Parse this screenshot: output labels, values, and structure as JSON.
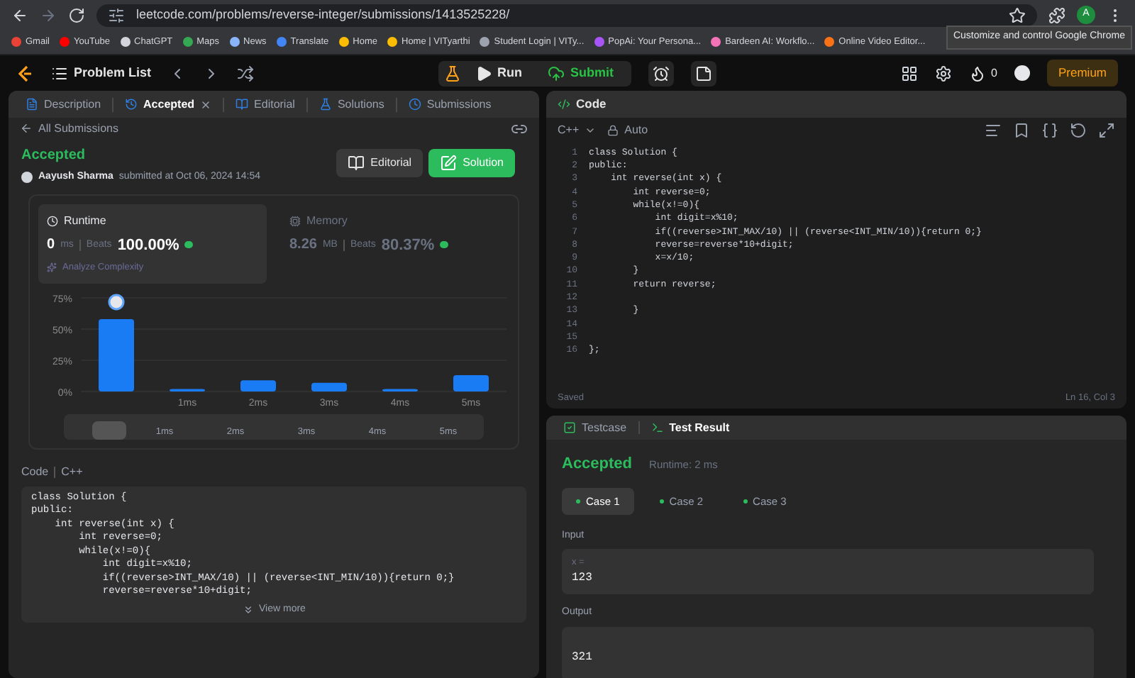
{
  "browser": {
    "url": "leetcode.com/problems/reverse-integer/submissions/1413525228/",
    "avatar": "A",
    "tooltip": "Customize and control Google Chrome",
    "bookmarks": [
      {
        "label": "Gmail",
        "color": "#ea4335"
      },
      {
        "label": "YouTube",
        "color": "#ff0000"
      },
      {
        "label": "ChatGPT",
        "color": "#d1d5db"
      },
      {
        "label": "Maps",
        "color": "#34a853"
      },
      {
        "label": "News",
        "color": "#8ab4f8"
      },
      {
        "label": "Translate",
        "color": "#4285f4"
      },
      {
        "label": "Home",
        "color": "#fbbc04"
      },
      {
        "label": "Home | VITyarthi",
        "color": "#fbbc04"
      },
      {
        "label": "Student Login | VITy...",
        "color": "#9ca3af"
      },
      {
        "label": "PopAi: Your Persona...",
        "color": "#a855f7"
      },
      {
        "label": "Bardeen AI: Workflo...",
        "color": "#f472b6"
      },
      {
        "label": "Online Video Editor...",
        "color": "#f97316"
      }
    ]
  },
  "nav": {
    "problem_list": "Problem List",
    "run": "Run",
    "submit": "Submit",
    "streak": "0",
    "premium": "Premium"
  },
  "left": {
    "tabs": [
      {
        "label": "Description",
        "selected": false
      },
      {
        "label": "Accepted",
        "selected": true,
        "closable": true
      },
      {
        "label": "Editorial",
        "selected": false
      },
      {
        "label": "Solutions",
        "selected": false
      },
      {
        "label": "Submissions",
        "selected": false
      }
    ],
    "back": "All Submissions",
    "status": "Accepted",
    "author": "Aayush Sharma",
    "submitted": "submitted at Oct 06, 2024 14:54",
    "editorial_button": "Editorial",
    "solution_button": "Solution",
    "runtime": {
      "title": "Runtime",
      "value": "0",
      "unit": "ms",
      "beats": "Beats",
      "percent": "100.00%",
      "analyze": "Analyze Complexity",
      "selected": true
    },
    "memory": {
      "title": "Memory",
      "value": "8.26",
      "unit": "MB",
      "beats": "Beats",
      "percent": "80.37%",
      "selected": false
    },
    "chart_data": {
      "type": "bar",
      "categories": [
        null,
        "1ms",
        "2ms",
        "3ms",
        "4ms",
        "5ms"
      ],
      "values": [
        58,
        2,
        9,
        7,
        2,
        13
      ],
      "ylim": [
        0,
        75
      ],
      "yticks": [
        {
          "value": 0,
          "label": "0%"
        },
        {
          "value": 25,
          "label": "25%"
        },
        {
          "value": 50,
          "label": "50%"
        },
        {
          "value": 75,
          "label": "75%"
        }
      ]
    },
    "brush_labels": [
      "1ms",
      "2ms",
      "3ms",
      "4ms",
      "5ms"
    ],
    "code_label": "Code",
    "language": "C++",
    "code_lines": [
      "class Solution {",
      "public:",
      "    int reverse(int x) {",
      "        int reverse=0;",
      "        while(x!=0){",
      "            int digit=x%10;",
      "            if((reverse>INT_MAX/10) || (reverse<INT_MIN/10)){return 0;}",
      "            reverse=reverse*10+digit;"
    ],
    "view_more": "View more"
  },
  "editor": {
    "title": "Code",
    "language": "C++",
    "mode": "Auto",
    "lines": [
      {
        "n": "1",
        "text": "class Solution {"
      },
      {
        "n": "2",
        "text": "public:"
      },
      {
        "n": "3",
        "text": "    int reverse(int x) {"
      },
      {
        "n": "4",
        "text": "        int reverse=0;"
      },
      {
        "n": "5",
        "text": "        while(x!=0){"
      },
      {
        "n": "6",
        "text": "            int digit=x%10;"
      },
      {
        "n": "7",
        "text": "            if((reverse>INT_MAX/10) || (reverse<INT_MIN/10)){return 0;}"
      },
      {
        "n": "8",
        "text": "            reverse=reverse*10+digit;"
      },
      {
        "n": "9",
        "text": "            x=x/10;"
      },
      {
        "n": "10",
        "text": "        }"
      },
      {
        "n": "11",
        "text": "        return reverse;"
      },
      {
        "n": "12"
      },
      {
        "n": "13",
        "text": "        }"
      },
      {
        "n": "14"
      },
      {
        "n": "15"
      },
      {
        "n": "16",
        "text": "};"
      }
    ],
    "saved": "Saved",
    "position": "Ln 16, Col 3"
  },
  "result": {
    "tabs": [
      {
        "label": "Testcase",
        "selected": false
      },
      {
        "label": "Test Result",
        "selected": true
      }
    ],
    "status": "Accepted",
    "runtime": "Runtime: 2 ms",
    "cases": [
      {
        "label": "Case 1",
        "selected": true
      },
      {
        "label": "Case 2",
        "selected": false
      },
      {
        "label": "Case 3",
        "selected": false
      }
    ],
    "input_label": "Input",
    "input_var": "x =",
    "input_value": "123",
    "output_label": "Output",
    "output_value": "321"
  }
}
